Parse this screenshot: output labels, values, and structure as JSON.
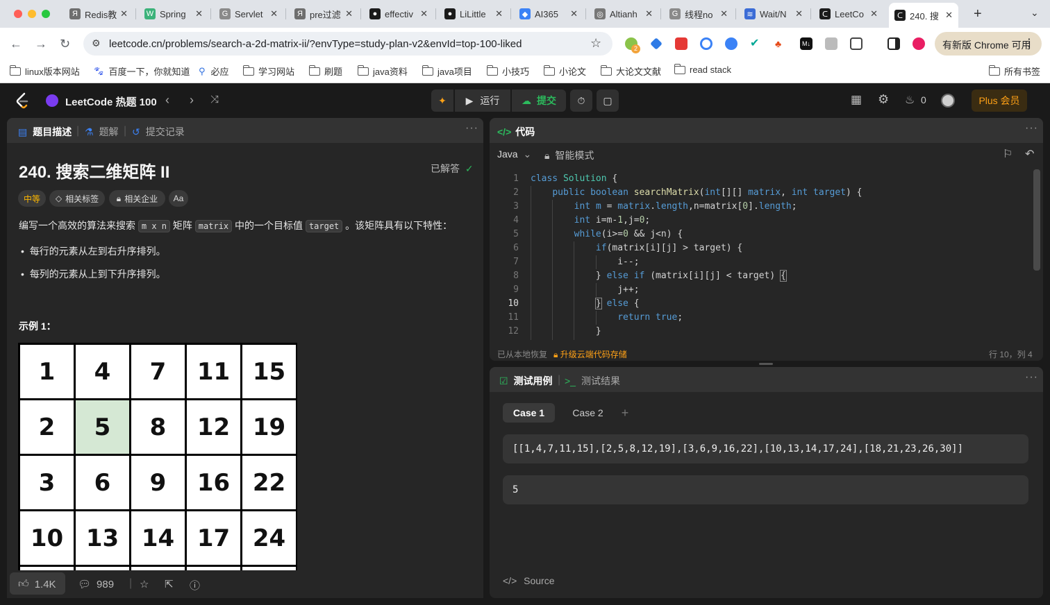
{
  "browser": {
    "tabs": [
      {
        "title": "Redis教",
        "fav_color": "#6e6e6e",
        "fav_glyph": "Я"
      },
      {
        "title": "Spring",
        "fav_color": "#3bb27a",
        "fav_glyph": "W"
      },
      {
        "title": "Servlet",
        "fav_color": "#8a8a8a",
        "fav_glyph": "G"
      },
      {
        "title": "pre过滤",
        "fav_color": "#6e6e6e",
        "fav_glyph": "Я"
      },
      {
        "title": "effectiv",
        "fav_color": "#1b1b1b",
        "fav_glyph": "●"
      },
      {
        "title": "LiLittle",
        "fav_color": "#1b1b1b",
        "fav_glyph": "●"
      },
      {
        "title": "AI365",
        "fav_color": "#3b82f6",
        "fav_glyph": "◆"
      },
      {
        "title": "Altianh",
        "fav_color": "#777777",
        "fav_glyph": "◎"
      },
      {
        "title": "线程no",
        "fav_color": "#8a8a8a",
        "fav_glyph": "G"
      },
      {
        "title": "Wait/N",
        "fav_color": "#3b6cd6",
        "fav_glyph": "≋"
      },
      {
        "title": "LeetCo",
        "fav_color": "#1b1b1b",
        "fav_glyph": "ᑕ"
      },
      {
        "title": "240. 搜",
        "fav_color": "#1b1b1b",
        "fav_glyph": "ᑕ"
      }
    ],
    "close_glyph": "✕",
    "new_tab": "+",
    "url": "leetcode.cn/problems/search-a-2d-matrix-ii/?envType=study-plan-v2&envId=top-100-liked",
    "chrome_update": "有新版 Chrome 可用",
    "extension_badge": "2",
    "bookmarks": [
      {
        "label": "linux版本网站",
        "icon": "folder-icon"
      },
      {
        "label": "百度一下，你就知道",
        "icon": "baidu-icon"
      },
      {
        "label": "必应",
        "icon": "search-icon"
      },
      {
        "label": "学习网站",
        "icon": "folder-icon"
      },
      {
        "label": "刷题",
        "icon": "folder-icon"
      },
      {
        "label": "java资料",
        "icon": "folder-icon"
      },
      {
        "label": "java项目",
        "icon": "folder-icon"
      },
      {
        "label": "小技巧",
        "icon": "folder-icon"
      },
      {
        "label": "小论文",
        "icon": "folder-icon"
      },
      {
        "label": "大论文文献",
        "icon": "folder-icon"
      },
      {
        "label": "read stack",
        "icon": "folder-icon"
      }
    ],
    "all_bookmarks": "所有书签"
  },
  "toolbar": {
    "study_plan": "LeetCode 热题 100",
    "run": "运行",
    "submit": "提交",
    "streak": "0",
    "plus": "Plus 会员"
  },
  "left": {
    "tabs": [
      "题目描述",
      "题解",
      "提交记录"
    ],
    "title": "240. 搜索二维矩阵 II",
    "solved": "已解答",
    "difficulty": "中等",
    "tags": [
      "相关标签",
      "相关企业",
      "Aa"
    ],
    "desc_pre": "编写一个高效的算法来搜索 ",
    "desc_code1": "m x n",
    "desc_mid1": " 矩阵 ",
    "desc_code2": "matrix",
    "desc_mid2": " 中的一个目标值 ",
    "desc_code3": "target",
    "desc_post": " 。该矩阵具有以下特性：",
    "bullets": [
      "每行的元素从左到右升序排列。",
      "每列的元素从上到下升序排列。"
    ],
    "example_heading": "示例 1：",
    "matrix": [
      [
        1,
        4,
        7,
        11,
        15
      ],
      [
        2,
        5,
        8,
        12,
        19
      ],
      [
        3,
        6,
        9,
        16,
        22
      ],
      [
        10,
        13,
        14,
        17,
        24
      ]
    ],
    "highlight": [
      1,
      1
    ],
    "likes": "1.4K",
    "comments": "989"
  },
  "code": {
    "header": "代码",
    "language": "Java",
    "mode": "智能模式",
    "restored": "已从本地恢复",
    "upgrade": "升级云端代码存储",
    "cursor": "行 10，列 4",
    "current_line": 10
  },
  "tests": {
    "tab_cases": "测试用例",
    "tab_result": "测试结果",
    "case_tabs": [
      "Case 1",
      "Case 2"
    ],
    "add": "+",
    "input_matrix": "[[1,4,7,11,15],[2,5,8,12,19],[3,6,9,16,22],[10,13,14,17,24],[18,21,23,26,30]]",
    "input_target": "5",
    "source": "Source"
  },
  "colors": {
    "accent_orange": "#ffa116",
    "submit_green": "#2cbb5d",
    "difficulty_yellow": "#ffb800",
    "solved_green": "#2cbb5d",
    "cell_highlight": "#d5e8d4"
  }
}
